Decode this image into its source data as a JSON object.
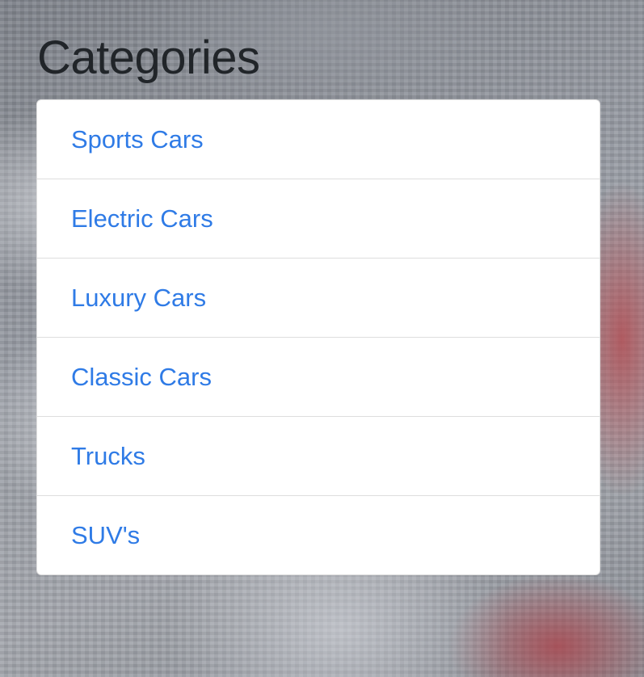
{
  "heading": "Categories",
  "categories": [
    {
      "label": "Sports Cars"
    },
    {
      "label": "Electric Cars"
    },
    {
      "label": "Luxury Cars"
    },
    {
      "label": "Classic Cars"
    },
    {
      "label": "Trucks"
    },
    {
      "label": "SUV's"
    }
  ],
  "colors": {
    "heading": "#212529",
    "link": "#2f7be6",
    "card_background": "#ffffff"
  }
}
